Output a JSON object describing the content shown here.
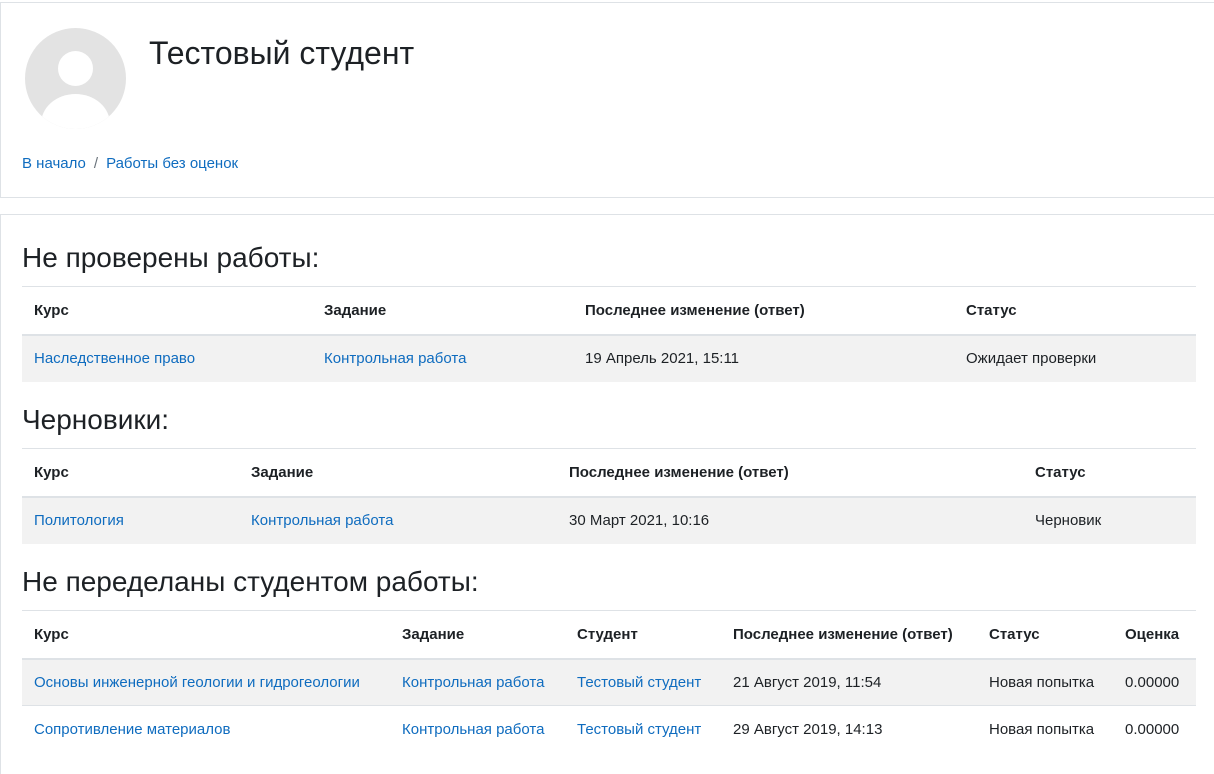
{
  "header": {
    "title": "Тестовый студент",
    "breadcrumb": {
      "home": "В начало",
      "separator": "/",
      "current": "Работы без оценок"
    }
  },
  "sections": {
    "unchecked": {
      "title": "Не проверены работы:",
      "columns": [
        "Курс",
        "Задание",
        "Последнее изменение (ответ)",
        "Статус"
      ],
      "rows": [
        {
          "course": "Наследственное право",
          "assignment": "Контрольная работа",
          "modified": "19 Апрель 2021, 15:11",
          "status": "Ожидает проверки"
        }
      ]
    },
    "drafts": {
      "title": "Черновики:",
      "columns": [
        "Курс",
        "Задание",
        "Последнее изменение (ответ)",
        "Статус"
      ],
      "rows": [
        {
          "course": "Политология",
          "assignment": "Контрольная работа",
          "modified": "30 Март 2021, 10:16",
          "status": "Черновик"
        }
      ]
    },
    "not_redone": {
      "title": "Не переделаны студентом работы:",
      "columns": [
        "Курс",
        "Задание",
        "Студент",
        "Последнее изменение (ответ)",
        "Статус",
        "Оценка"
      ],
      "rows": [
        {
          "course": "Основы инженерной геологии и гидрогеологии",
          "assignment": "Контрольная работа",
          "student": "Тестовый студент",
          "modified": "21 Август 2019, 11:54",
          "status": "Новая попытка",
          "grade": "0.00000"
        },
        {
          "course": "Сопротивление материалов",
          "assignment": "Контрольная работа",
          "student": "Тестовый студент",
          "modified": "29 Август 2019, 14:13",
          "status": "Новая попытка",
          "grade": "0.00000"
        }
      ]
    }
  },
  "colors": {
    "link": "#0f6cbf",
    "text": "#1d2125",
    "row_stripe": "#f2f2f2",
    "border": "#dee2e6"
  }
}
